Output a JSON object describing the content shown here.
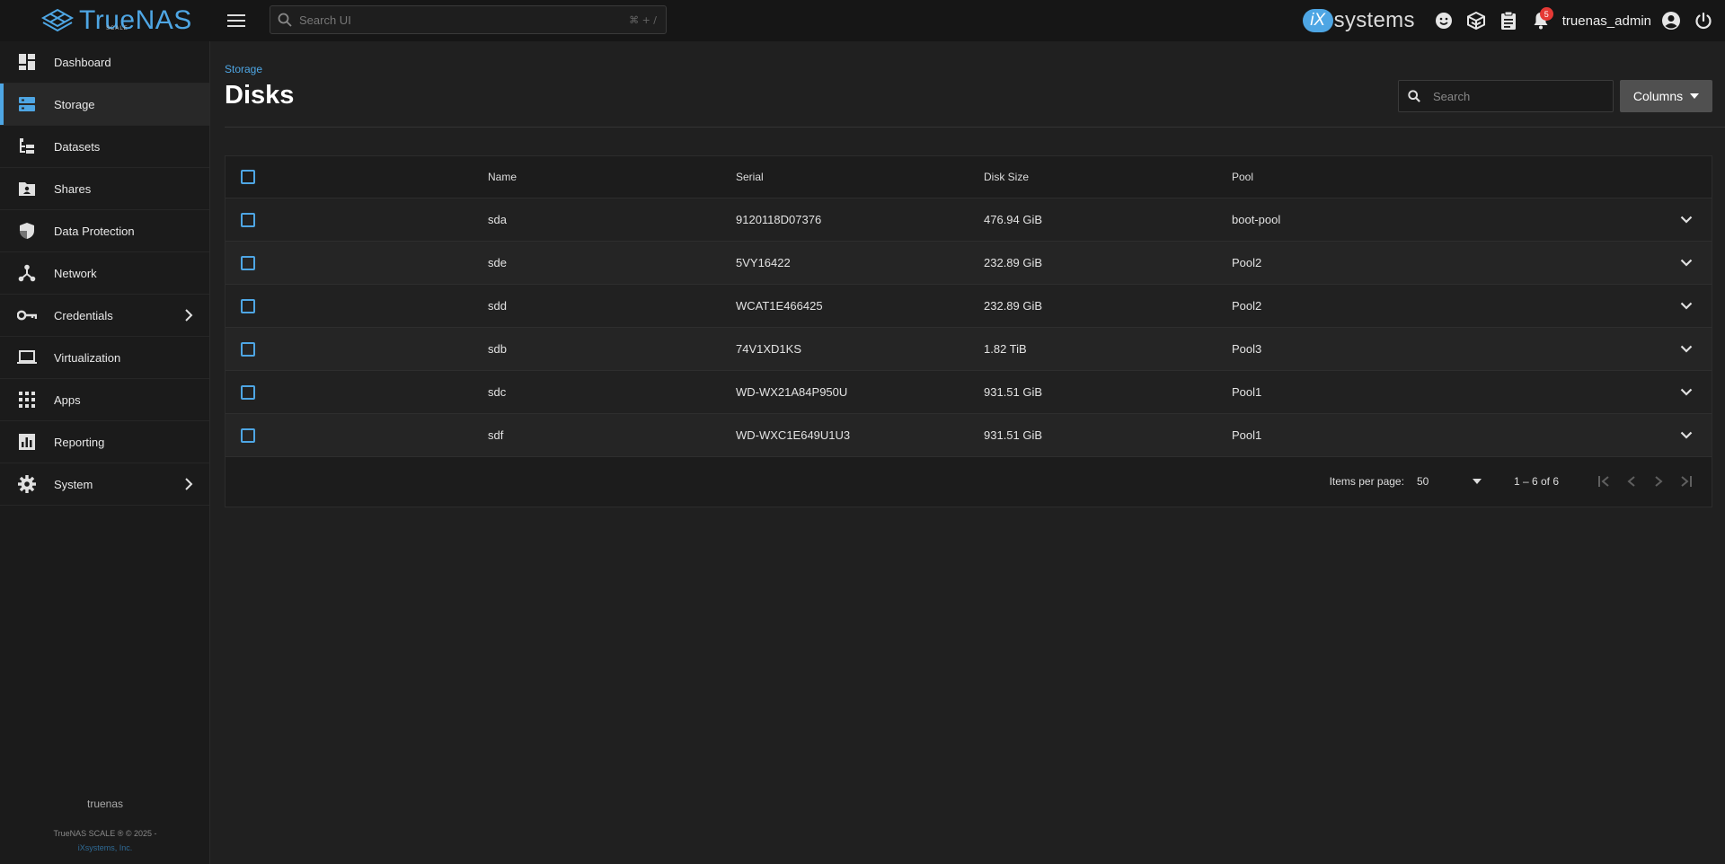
{
  "brand": {
    "name": "TrueNAS",
    "edition": "SCALE"
  },
  "global_search": {
    "placeholder": "Search UI",
    "shortcut": "⌘ + /"
  },
  "topbar": {
    "vendor_mark": "iX",
    "vendor_text": "systems",
    "notification_count": "5",
    "username": "truenas_admin"
  },
  "sidebar": {
    "items": [
      {
        "label": "Dashboard",
        "icon": "dashboard-icon"
      },
      {
        "label": "Storage",
        "icon": "storage-icon",
        "active": true
      },
      {
        "label": "Datasets",
        "icon": "datasets-icon"
      },
      {
        "label": "Shares",
        "icon": "shares-icon"
      },
      {
        "label": "Data Protection",
        "icon": "shield-icon"
      },
      {
        "label": "Network",
        "icon": "network-icon"
      },
      {
        "label": "Credentials",
        "icon": "key-icon",
        "has_children": true
      },
      {
        "label": "Virtualization",
        "icon": "laptop-icon"
      },
      {
        "label": "Apps",
        "icon": "apps-grid-icon"
      },
      {
        "label": "Reporting",
        "icon": "chart-icon"
      },
      {
        "label": "System",
        "icon": "gear-icon",
        "has_children": true
      }
    ],
    "hostname": "truenas",
    "copyright": "TrueNAS SCALE ® © 2025 -",
    "company": "iXsystems, Inc."
  },
  "main": {
    "breadcrumb": "Storage",
    "title": "Disks",
    "search_placeholder": "Search",
    "columns_button": "Columns"
  },
  "table": {
    "headers": {
      "name": "Name",
      "serial": "Serial",
      "size": "Disk Size",
      "pool": "Pool"
    },
    "rows": [
      {
        "name": "sda",
        "serial": "9120118D07376",
        "size": "476.94 GiB",
        "pool": "boot-pool"
      },
      {
        "name": "sde",
        "serial": "5VY16422",
        "size": "232.89 GiB",
        "pool": "Pool2"
      },
      {
        "name": "sdd",
        "serial": "WCAT1E466425",
        "size": "232.89 GiB",
        "pool": "Pool2"
      },
      {
        "name": "sdb",
        "serial": "74V1XD1KS",
        "size": "1.82 TiB",
        "pool": "Pool3"
      },
      {
        "name": "sdc",
        "serial": "WD-WX21A84P950U",
        "size": "931.51 GiB",
        "pool": "Pool1"
      },
      {
        "name": "sdf",
        "serial": "WD-WXC1E649U1U3",
        "size": "931.51 GiB",
        "pool": "Pool1"
      }
    ],
    "paginator": {
      "items_per_page_label": "Items per page:",
      "items_per_page": "50",
      "range": "1 – 6 of 6"
    }
  },
  "colors": {
    "accent": "#4ea6e4",
    "badge": "#e53935",
    "background": "#202020",
    "sidebar": "#1b1b1b",
    "topbar": "#161616"
  }
}
